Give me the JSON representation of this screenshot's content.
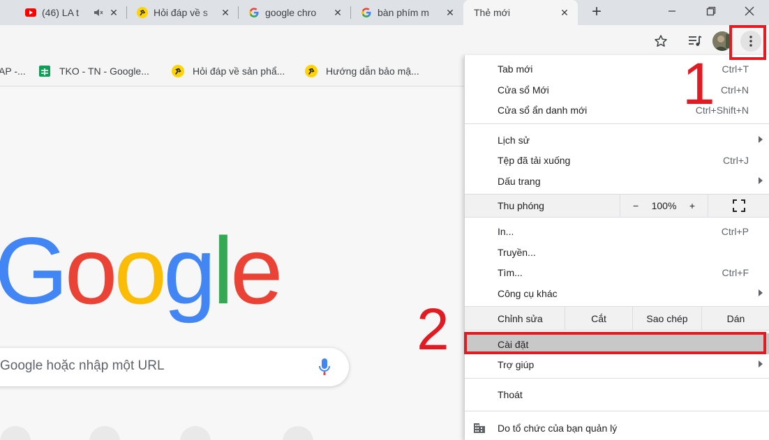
{
  "tabs": [
    {
      "title": "(46) LA t",
      "icon": "youtube-icon",
      "muted": true
    },
    {
      "title": "Hỏi đáp về s",
      "icon": "tgdd-icon"
    },
    {
      "title": "google chro",
      "icon": "google-icon"
    },
    {
      "title": "bàn phím m",
      "icon": "google-icon"
    },
    {
      "title": "Thẻ mới",
      "icon": "",
      "active": true
    }
  ],
  "tab_close_glyph": "✕",
  "new_tab_glyph": "+",
  "bookmarks": [
    {
      "label": "AP -...",
      "icon": ""
    },
    {
      "label": "TKO - TN - Google...",
      "icon": "sheets-icon"
    },
    {
      "label": "Hỏi đáp về sản phẩ...",
      "icon": "tgdd-icon"
    },
    {
      "label": "Hướng dẫn bảo mậ...",
      "icon": "tgdd-icon"
    }
  ],
  "page": {
    "logo": [
      "G",
      "o",
      "o",
      "g",
      "l",
      "e"
    ],
    "logo_colors": [
      "#4285F4",
      "#EA4335",
      "#FBBC05",
      "#4285F4",
      "#34A853",
      "#EA4335"
    ],
    "search_placeholder": "Google hoặc nhập một URL"
  },
  "menu": {
    "new_tab": {
      "label": "Tab mới",
      "shortcut": "Ctrl+T"
    },
    "new_window": {
      "label": "Cửa sổ Mới",
      "shortcut": "Ctrl+N"
    },
    "incognito": {
      "label": "Cửa sổ ẩn danh mới",
      "shortcut": "Ctrl+Shift+N"
    },
    "history": {
      "label": "Lịch sử"
    },
    "downloads": {
      "label": "Tệp đã tải xuống",
      "shortcut": "Ctrl+J"
    },
    "bookmarks": {
      "label": "Dấu trang"
    },
    "zoom": {
      "label": "Thu phóng",
      "minus": "−",
      "value": "100%",
      "plus": "+"
    },
    "print": {
      "label": "In...",
      "shortcut": "Ctrl+P"
    },
    "cast": {
      "label": "Truyền..."
    },
    "find": {
      "label": "Tìm...",
      "shortcut": "Ctrl+F"
    },
    "more_tools": {
      "label": "Công cụ khác"
    },
    "edit": {
      "label": "Chỉnh sửa",
      "cut": "Cắt",
      "copy": "Sao chép",
      "paste": "Dán"
    },
    "settings": {
      "label": "Cài đặt"
    },
    "help": {
      "label": "Trợ giúp"
    },
    "exit": {
      "label": "Thoát"
    },
    "managed": {
      "label": "Do tổ chức của bạn quản lý"
    }
  },
  "annotations": {
    "step1": "1",
    "step2": "2",
    "color": "#e21b23"
  }
}
